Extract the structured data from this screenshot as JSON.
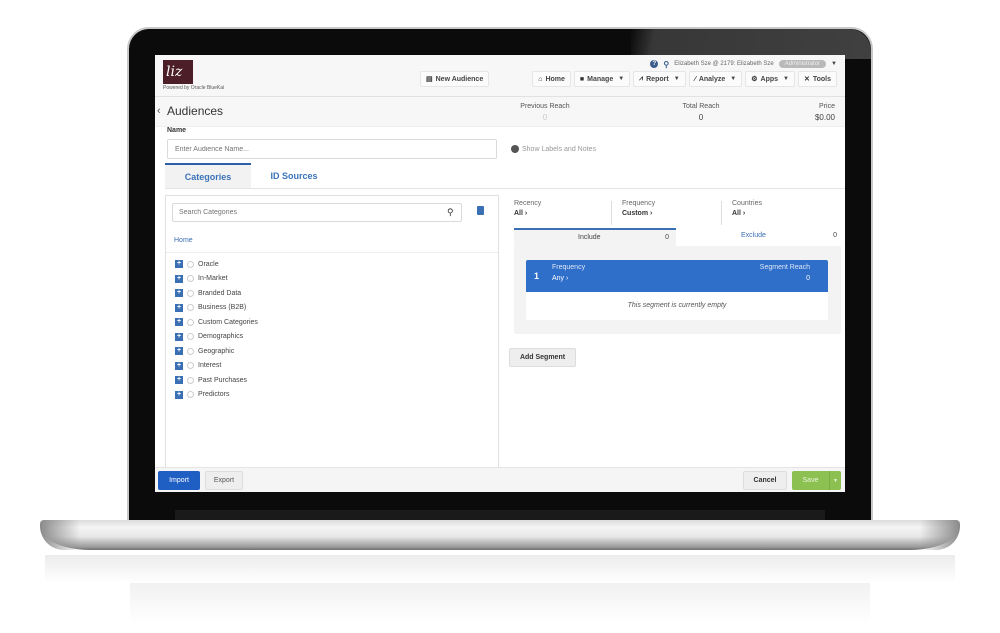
{
  "header": {
    "logo_text": "liz",
    "powered_by": "Powered by Oracle BlueKai",
    "user": "Elizabeth Sze @ 2179: Elizabeth Sze",
    "role_badge": "Administrator",
    "new_audience": "New Audience",
    "nav": [
      {
        "label": "Home",
        "icon": "home-icon",
        "glyph": "⌂",
        "dropdown": false
      },
      {
        "label": "Manage",
        "icon": "folder-icon",
        "glyph": "■",
        "dropdown": true
      },
      {
        "label": "Report",
        "icon": "chart-icon",
        "glyph": "⩘",
        "dropdown": true
      },
      {
        "label": "Analyze",
        "icon": "wand-icon",
        "glyph": "⁄",
        "dropdown": true
      },
      {
        "label": "Apps",
        "icon": "apps-icon",
        "glyph": "⚙",
        "dropdown": true
      },
      {
        "label": "Tools",
        "icon": "tools-icon",
        "glyph": "✕",
        "dropdown": false
      }
    ]
  },
  "page": {
    "title": "Audiences",
    "stats": [
      {
        "label": "Previous Reach",
        "value": "0"
      },
      {
        "label": "Total Reach",
        "value": "0"
      },
      {
        "label": "Price",
        "value": "$0.00"
      }
    ],
    "name_label": "Name",
    "name_placeholder": "Enter Audience Name...",
    "name_value": "",
    "show_labels": "Show Labels and Notes",
    "tabs": [
      {
        "label": "Categories",
        "active": true
      },
      {
        "label": "ID Sources",
        "active": false
      }
    ]
  },
  "categories": {
    "search_placeholder": "Search Categories",
    "home": "Home",
    "items": [
      "Oracle",
      "In-Market",
      "Branded Data",
      "Business (B2B)",
      "Custom Categories",
      "Demographics",
      "Geographic",
      "Interest",
      "Past Purchases",
      "Predictors"
    ]
  },
  "filters": [
    {
      "label": "Recency",
      "value": "All"
    },
    {
      "label": "Frequency",
      "value": "Custom"
    },
    {
      "label": "Countries",
      "value": "All"
    }
  ],
  "segments": {
    "include_label": "Include",
    "include_count": "0",
    "exclude_label": "Exclude",
    "exclude_count": "0",
    "segment": {
      "number": "1",
      "frequency_label": "Frequency",
      "frequency_value": "Any",
      "reach_label": "Segment Reach",
      "reach_value": "0",
      "empty_text": "This segment is currently empty"
    },
    "add_segment": "Add Segment"
  },
  "footer": {
    "import": "Import",
    "export": "Export",
    "cancel": "Cancel",
    "save": "Save"
  },
  "colors": {
    "primary": "#2f6ec9",
    "link": "#3b6fb4",
    "save": "#8cc152",
    "logo_bg": "#4b1e28"
  }
}
